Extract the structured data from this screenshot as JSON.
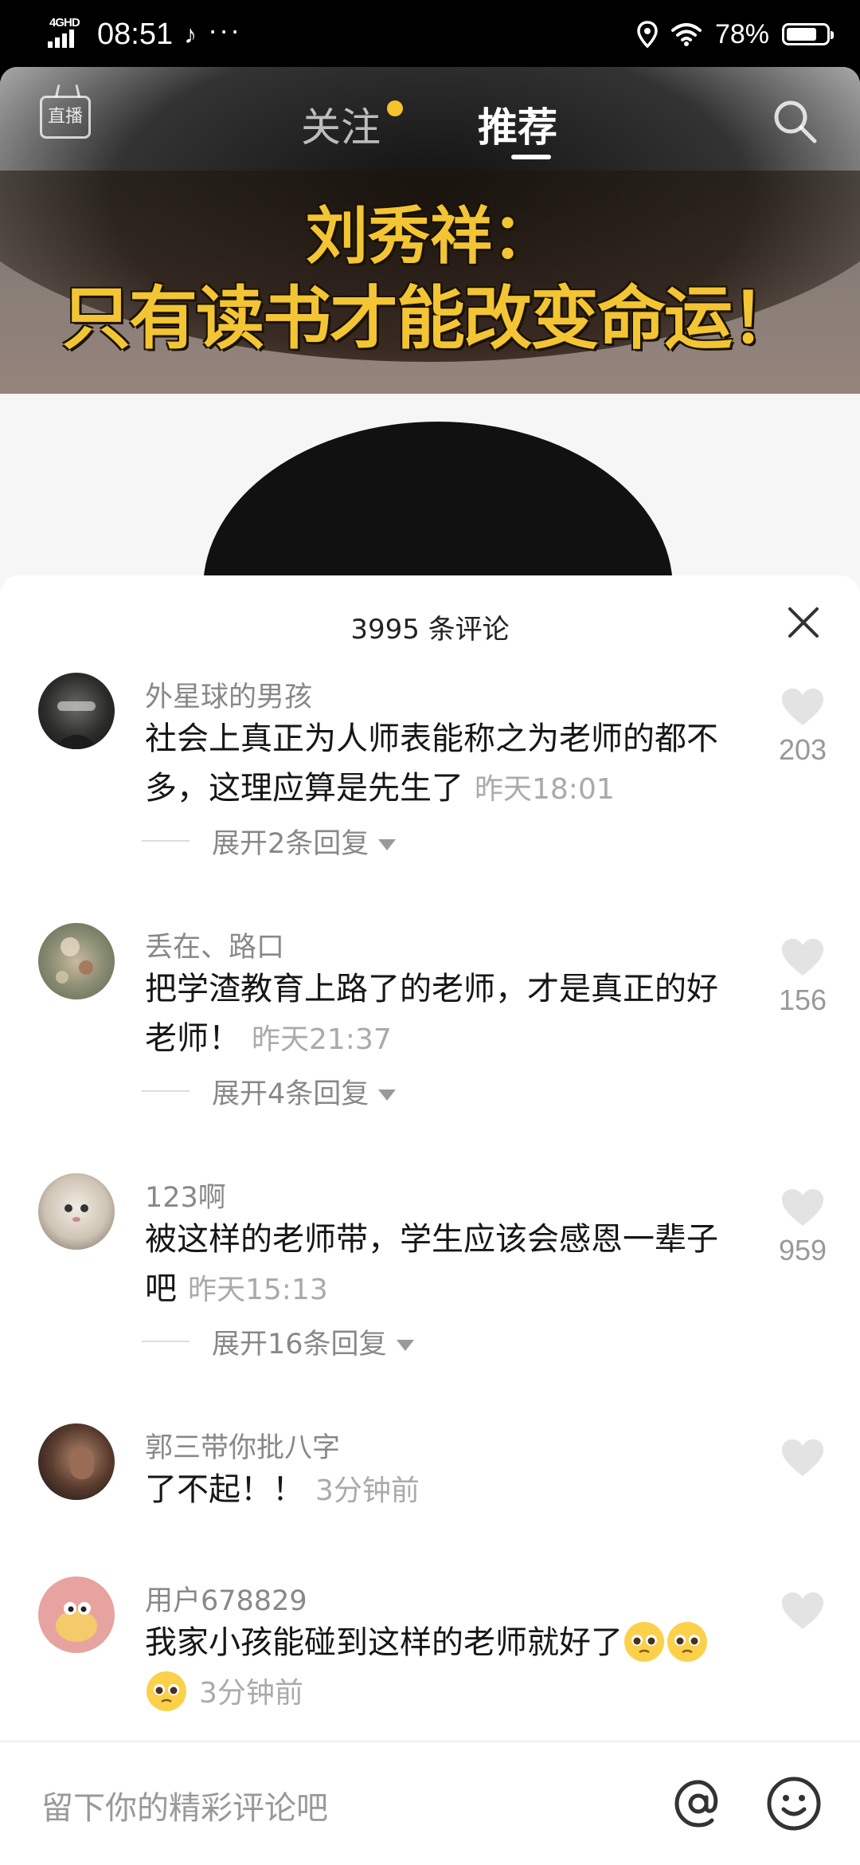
{
  "status_bar": {
    "network": "4GHD",
    "time": "08:51",
    "battery": "78%",
    "battery_level": 0.78
  },
  "top_nav": {
    "live_label": "直播",
    "tab_follow": "关注",
    "tab_recommend": "推荐"
  },
  "video": {
    "caption_line1": "刘秀祥：",
    "caption_line2": "只有读书才能改变命运！"
  },
  "comments_sheet": {
    "title": "3995 条评论",
    "comments": [
      {
        "name": "外星球的男孩",
        "text": "社会上真正为人师表能称之为老师的都不多，这理应算是先生了",
        "time": "昨天18:01",
        "likes": "203",
        "expand": "展开2条回复"
      },
      {
        "name": "丢在、路口",
        "text": "把学渣教育上路了的老师，才是真正的好老师！",
        "time": "昨天21:37",
        "likes": "156",
        "expand": "展开4条回复"
      },
      {
        "name": "123啊",
        "text": "被这样的老师带，学生应该会感恩一辈子吧",
        "time": "昨天15:13",
        "likes": "959",
        "expand": "展开16条回复"
      },
      {
        "name": "郭三带你批八字",
        "text": "了不起！！",
        "time": "3分钟前",
        "likes": "",
        "expand": ""
      },
      {
        "name": "用户678829",
        "text": "我家小孩能碰到这样的老师就好了",
        "time": "3分钟前",
        "likes": "",
        "expand": "",
        "emoji": "pleading-face"
      }
    ]
  },
  "input": {
    "placeholder": "留下你的精彩评论吧"
  },
  "colors": {
    "follow_dot": "#f8c22c",
    "caption_yellow": "#f3c534"
  }
}
